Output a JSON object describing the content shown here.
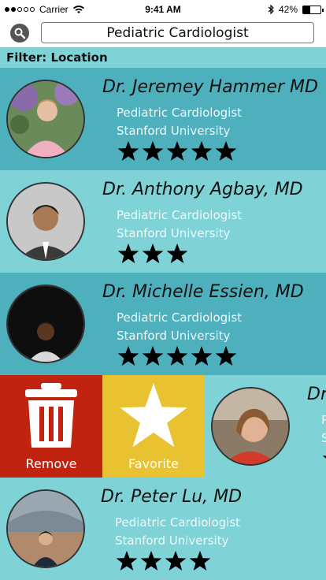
{
  "status_bar": {
    "carrier": "Carrier",
    "time": "9:41 AM",
    "battery": "42%",
    "battery_level": 0.42,
    "signal_dots_filled": 2,
    "signal_dots_total": 5
  },
  "search": {
    "query": "Pediatric Cardiologist",
    "icon": "search-icon"
  },
  "filter": {
    "label": "Filter: Location"
  },
  "doctors": [
    {
      "name": "Dr. Jeremey Hammer MD",
      "specialty": "Pediatric Cardiologist",
      "institution": "Stanford University",
      "rating": 5
    },
    {
      "name": "Dr. Anthony Agbay, MD",
      "specialty": "Pediatric Cardiologist",
      "institution": "Stanford University",
      "rating": 3
    },
    {
      "name": "Dr. Michelle Essien, MD",
      "specialty": "Pediatric Cardiologist",
      "institution": "Stanford University",
      "rating": 5
    },
    {
      "name": "Dr",
      "specialty": "P",
      "institution": "S",
      "rating": 1
    },
    {
      "name": "Dr. Peter Lu, MD",
      "specialty": "Pediatric Cardiologist",
      "institution": "Stanford University",
      "rating": 4
    }
  ],
  "swipe_actions": {
    "remove_label": "Remove",
    "favorite_label": "Favorite",
    "remove_color": "#c02410",
    "favorite_color": "#e9c232"
  },
  "colors": {
    "row_dark": "#4eb0bd",
    "row_light": "#7fd3d6",
    "star": "#000000"
  }
}
